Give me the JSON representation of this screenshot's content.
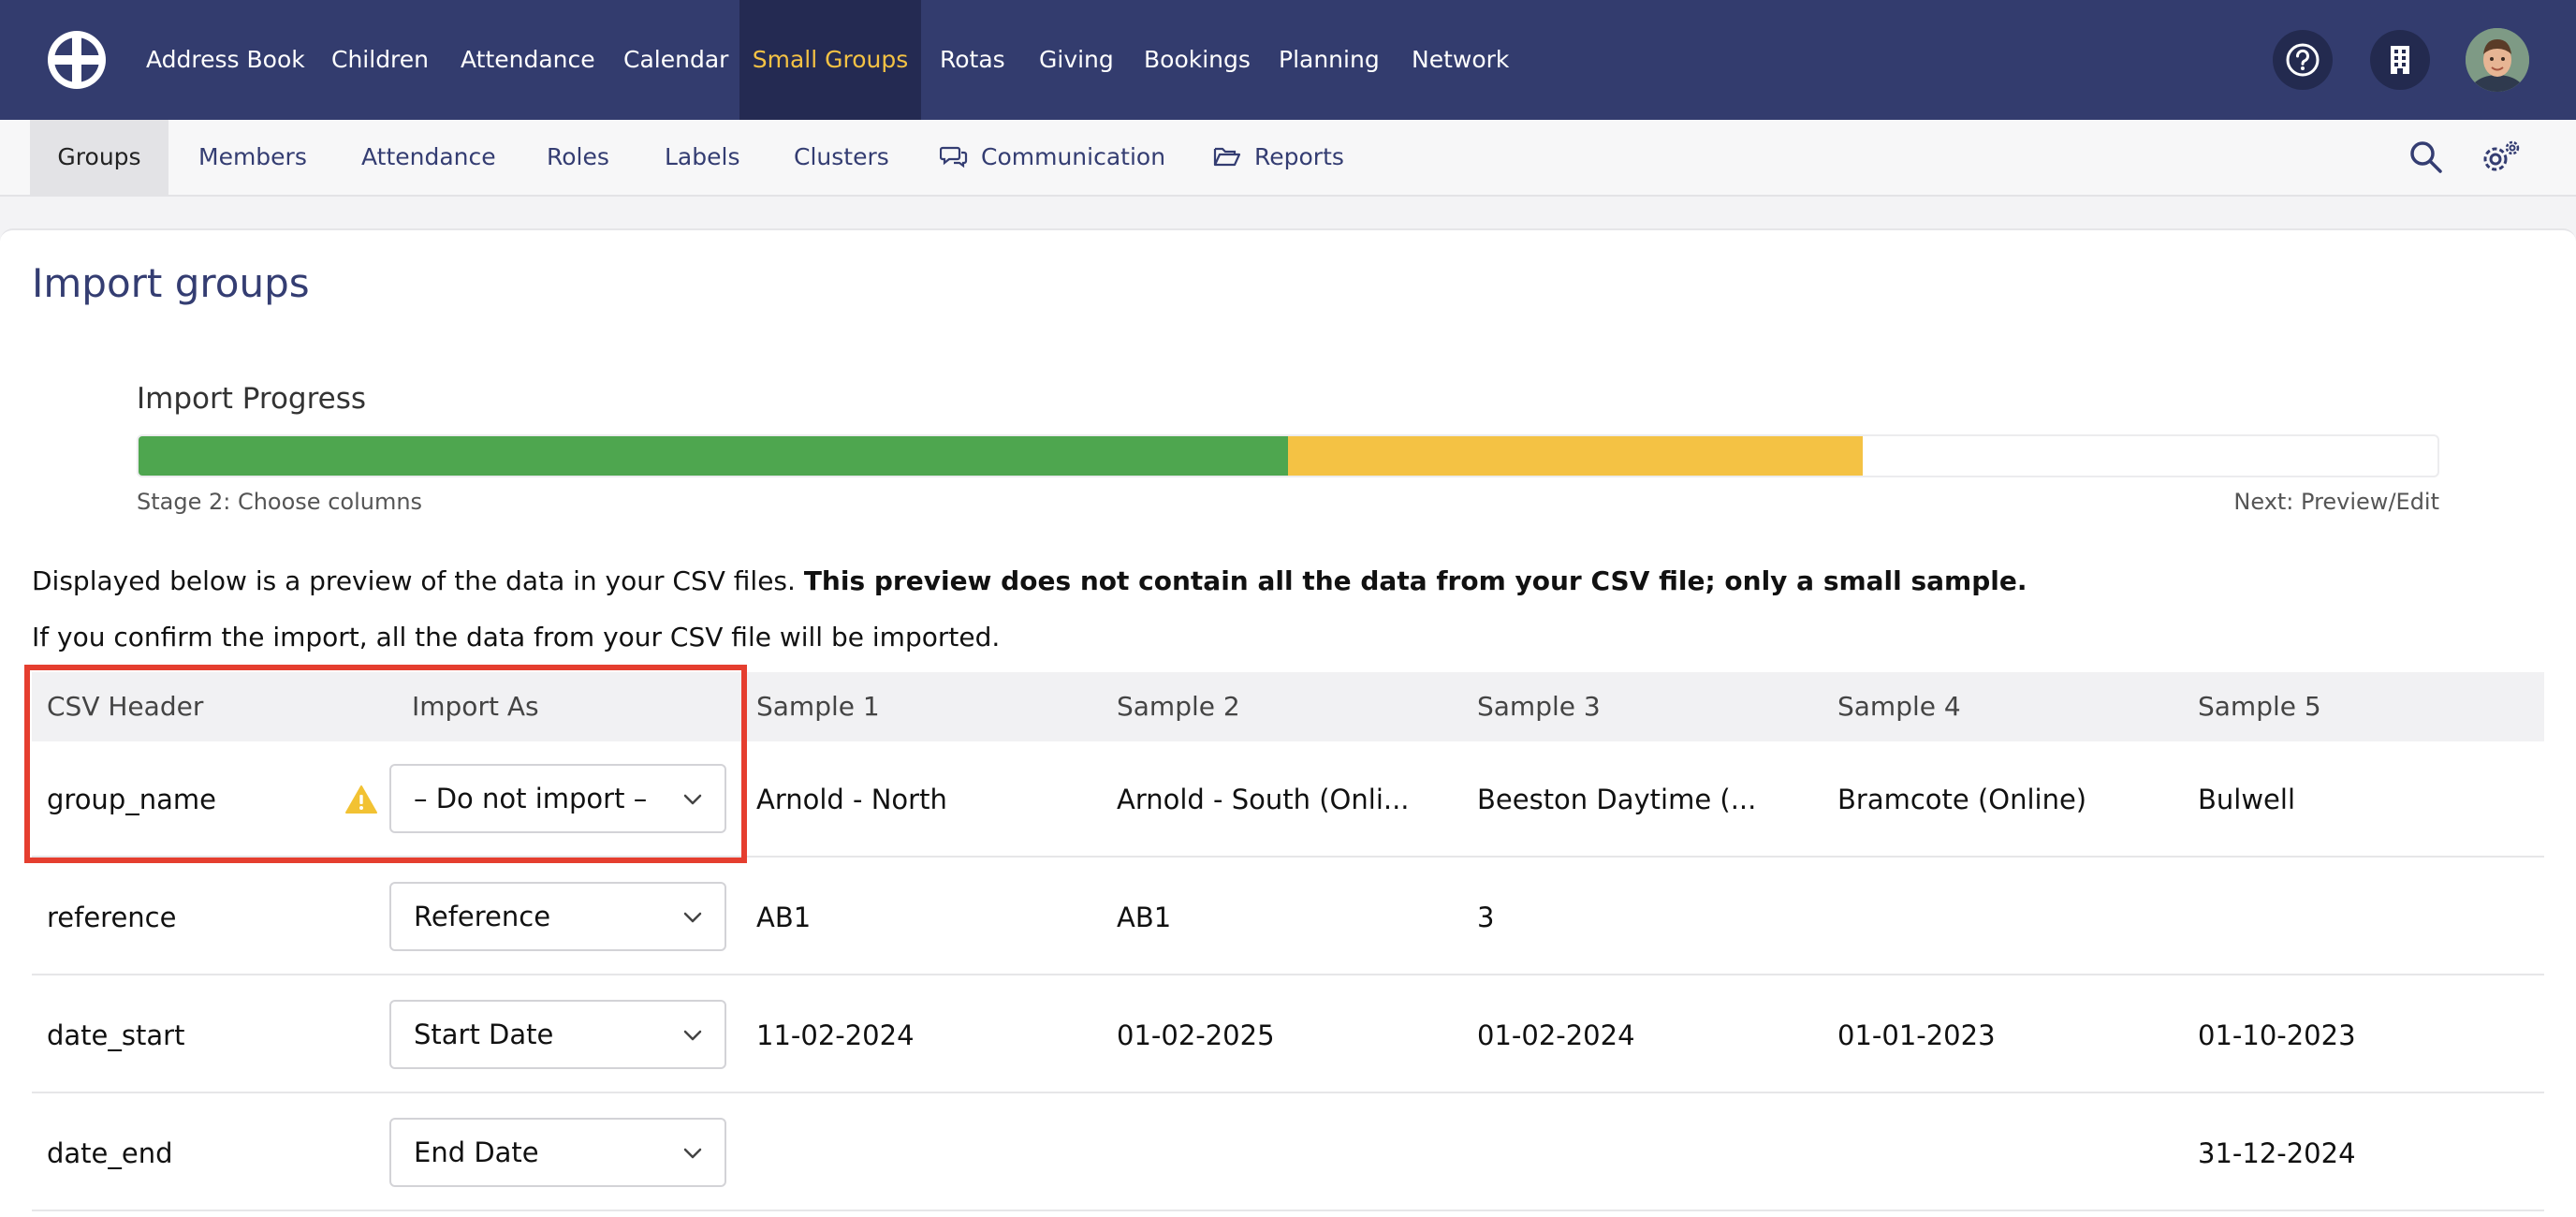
{
  "topnav": {
    "items": [
      "Address Book",
      "Children",
      "Attendance",
      "Calendar",
      "Small Groups",
      "Rotas",
      "Giving",
      "Bookings",
      "Planning",
      "Network"
    ],
    "active_index": 4,
    "icons": [
      "help-icon",
      "building-icon"
    ],
    "colors": {
      "background": "#333c6e",
      "active_background": "#242a52",
      "active_text": "#f4c244"
    }
  },
  "subnav": {
    "items": [
      "Groups",
      "Members",
      "Attendance",
      "Roles",
      "Labels",
      "Clusters",
      "Communication",
      "Reports"
    ],
    "active_index": 0,
    "icons": [
      "search-icon",
      "settings-icon"
    ]
  },
  "page": {
    "title": "Import groups",
    "progress_label": "Import Progress",
    "progress": {
      "done_fraction": 0.5,
      "current_fraction": 0.25
    },
    "stage_label": "Stage 2: Choose columns",
    "next_label": "Next: Preview/Edit",
    "intro_text": "Displayed below is a preview of the data in your CSV files. ",
    "intro_bold": "This preview does not contain all the data from your CSV file; only a small sample.",
    "intro_line2": "If you confirm the import, all the data from your CSV file will be imported."
  },
  "table": {
    "headers": [
      "CSV Header",
      "Import As",
      "Sample 1",
      "Sample 2",
      "Sample 3",
      "Sample 4",
      "Sample 5"
    ],
    "rows": [
      {
        "header": "group_name",
        "warning": true,
        "import_as": "– Do not import –",
        "samples": [
          "Arnold - North",
          "Arnold - South (Onli...",
          "Beeston Daytime (...",
          "Bramcote (Online)",
          "Bulwell"
        ]
      },
      {
        "header": "reference",
        "warning": false,
        "import_as": "Reference",
        "samples": [
          "AB1",
          "AB1",
          "3",
          "",
          ""
        ]
      },
      {
        "header": "date_start",
        "warning": false,
        "import_as": "Start Date",
        "samples": [
          "11-02-2024",
          "01-02-2025",
          "01-02-2024",
          "01-01-2023",
          "01-10-2023"
        ]
      },
      {
        "header": "date_end",
        "warning": false,
        "import_as": "End Date",
        "samples": [
          "",
          "",
          "",
          "",
          "31-12-2024"
        ]
      }
    ]
  }
}
